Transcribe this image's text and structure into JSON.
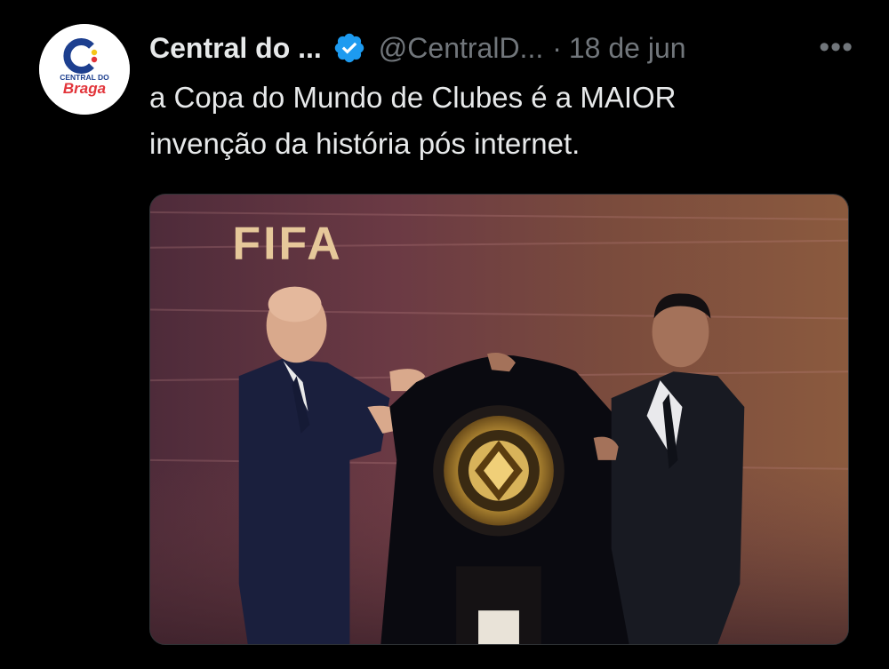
{
  "tweet": {
    "author": {
      "display_name": "Central do ...",
      "handle": "@CentralD...",
      "verified": true,
      "avatar_text": [
        "CENTRAL DO",
        "Braga"
      ]
    },
    "separator": "·",
    "date": "18 de jun",
    "more_icon": "more-horizontal-icon",
    "text_lines": [
      "a Copa do Mundo de Clubes é a MAIOR",
      "invenção da história pós internet."
    ],
    "media": {
      "sign_text": "FIFA"
    }
  },
  "colors": {
    "background": "#000000",
    "text_primary": "#e7e9ea",
    "text_secondary": "#71767b",
    "verified_blue": "#1d9bf0",
    "avatar_brand_red": "#e2343a",
    "avatar_brand_blue": "#1d3f8f",
    "avatar_brand_yellow": "#f5c518"
  }
}
